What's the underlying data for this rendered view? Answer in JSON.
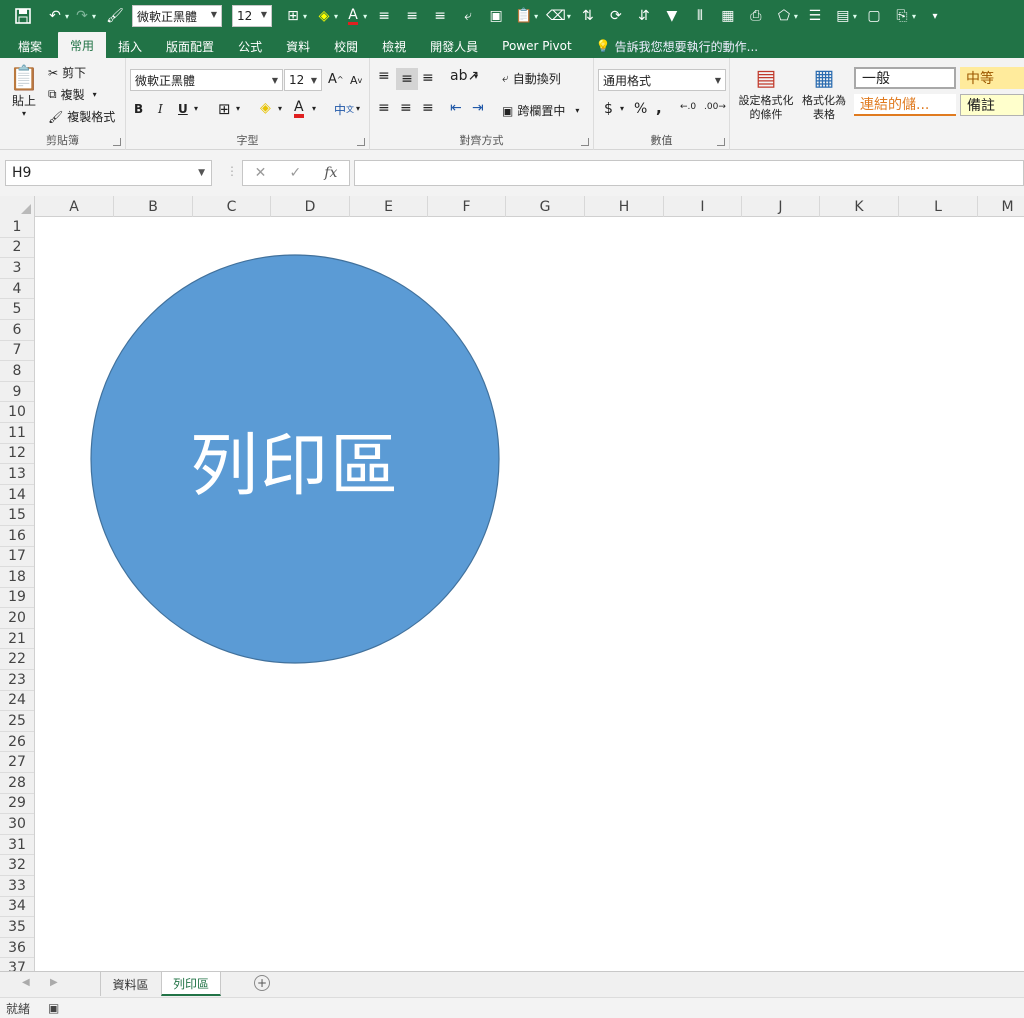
{
  "quick_access": {
    "font_name": "微軟正黑體",
    "font_size": "12"
  },
  "tabs": [
    {
      "label": "檔案"
    },
    {
      "label": "常用",
      "active": true
    },
    {
      "label": "插入"
    },
    {
      "label": "版面配置"
    },
    {
      "label": "公式"
    },
    {
      "label": "資料"
    },
    {
      "label": "校閱"
    },
    {
      "label": "檢視"
    },
    {
      "label": "開發人員"
    },
    {
      "label": "Power Pivot"
    }
  ],
  "tell_me": "告訴我您想要執行的動作...",
  "ribbon": {
    "clipboard": {
      "paste": "貼上",
      "cut": "剪下",
      "copy": "複製",
      "format_painter": "複製格式",
      "label": "剪貼簿"
    },
    "font": {
      "name": "微軟正黑體",
      "size": "12",
      "bold": "B",
      "italic": "I",
      "underline": "U",
      "label": "字型"
    },
    "alignment": {
      "wrap_text": "自動換列",
      "merge_center": "跨欄置中",
      "label": "對齊方式"
    },
    "number": {
      "format": "通用格式",
      "currency": "$",
      "percent": "%",
      "comma": ",",
      "label": "數值"
    },
    "styles": {
      "conditional_formatting": "設定格式化的條件",
      "conditional_formatting_line1": "設定格式化",
      "conditional_formatting_line2": "的條件",
      "format_as_table_line1": "格式化為",
      "format_as_table_line2": "表格",
      "normal": "一般",
      "neutral": "中等",
      "hyperlink": "連結的儲...",
      "note": "備註"
    }
  },
  "formula_bar": {
    "name_box": "H9",
    "formula": ""
  },
  "columns": [
    "A",
    "B",
    "C",
    "D",
    "E",
    "F",
    "G",
    "H",
    "I",
    "J",
    "K",
    "L",
    "M"
  ],
  "rows": [
    "1",
    "2",
    "3",
    "4",
    "5",
    "6",
    "7",
    "8",
    "9",
    "10",
    "11",
    "12",
    "13",
    "14",
    "15",
    "16",
    "17",
    "18",
    "19",
    "20",
    "21",
    "22",
    "23",
    "24",
    "25",
    "26",
    "27",
    "28",
    "29",
    "30",
    "31",
    "32",
    "33",
    "34",
    "35",
    "36",
    "37"
  ],
  "shape": {
    "text": "列印區",
    "fill": "#5b9bd5",
    "stroke": "#41719c"
  },
  "sheet_tabs": [
    {
      "label": "資料區"
    },
    {
      "label": "列印區",
      "active": true
    }
  ],
  "status": {
    "ready": "就緒"
  },
  "colors": {
    "accent": "#217346"
  }
}
